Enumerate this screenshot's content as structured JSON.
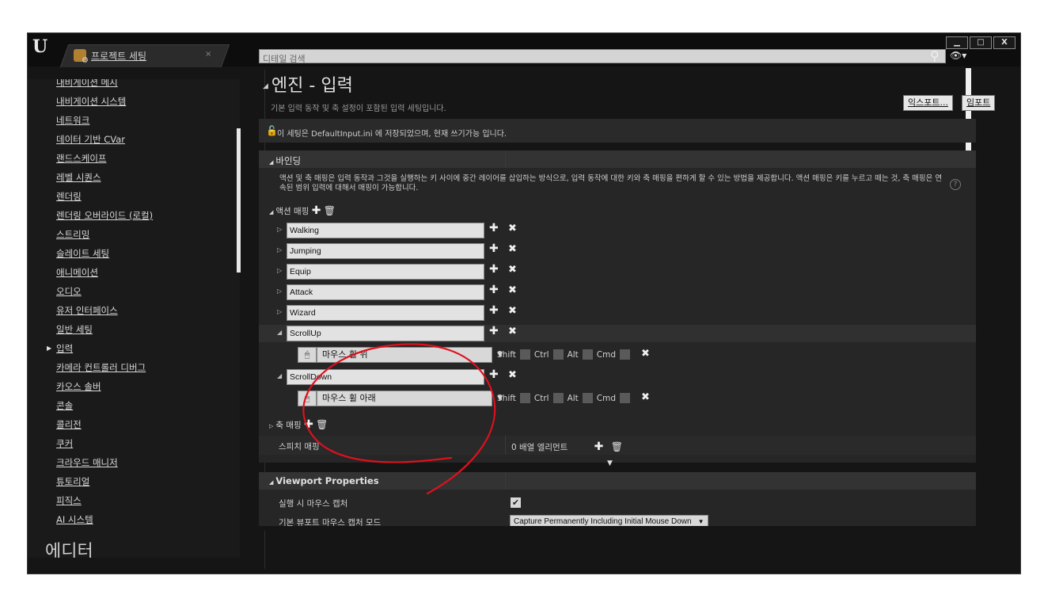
{
  "window": {
    "tab_title": "프로젝트 세팅",
    "tab_close": "×",
    "controls": {
      "minimize": "▁",
      "maximize": "□",
      "close": "X"
    }
  },
  "sidebar": {
    "items": [
      "내비게이션 메시",
      "내비게이션 시스템",
      "네트워크",
      "데이터 기반 CVar",
      "랜드스케이프",
      "레벨 시퀀스",
      "렌더링",
      "렌더링 오버라이드 (로컬)",
      "스트리밍",
      "슬레이트 세팅",
      "애니메이션",
      "오디오",
      "유저 인터페이스",
      "일반 세팅",
      "입력",
      "카메라 컨트롤러 디버그",
      "카오스 솔버",
      "콘솔",
      "콜리전",
      "쿠커",
      "크라우드 매니저",
      "튜토리얼",
      "피직스",
      "AI 시스템"
    ],
    "selected": "입력",
    "next_section": "에디터"
  },
  "search": {
    "placeholder": "디테일 검색"
  },
  "header": {
    "title": "엔진 - 입력",
    "description": "기본 입력 동작 및 축 설정이 포함된 입력 세팅입니다.",
    "export_label": "익스포트...",
    "import_label": "임포트"
  },
  "info": {
    "text": "이 세팅은 DefaultInput.ini 에 저장되었으며, 현재 쓰기가능 입니다."
  },
  "bindings": {
    "title": "바인딩",
    "description": "액션 및 축 매핑은 입력 동작과 그것을 실행하는 키 사이에 중간 레이어를 삽입하는 방식으로, 입력 동작에 대한 키와 축 매핑을 편하게 할 수 있는 방법을 제공합니다. 액션 매핑은 키를 누르고 떼는 것, 축 매핑은 연속된 범위 입력에 대해서 매핑이 가능합니다.",
    "action_mappings_label": "액션 매핑",
    "actions": [
      {
        "name": "Walking"
      },
      {
        "name": "Jumping"
      },
      {
        "name": "Equip"
      },
      {
        "name": "Attack"
      },
      {
        "name": "Wizard"
      },
      {
        "name": "ScrollUp",
        "key": "마우스 휠 위"
      },
      {
        "name": "ScrollDown",
        "key": "마우스 휠 아래"
      }
    ],
    "modifiers": {
      "shift": "Shift",
      "ctrl": "Ctrl",
      "alt": "Alt",
      "cmd": "Cmd"
    },
    "axis_mappings_label": "축 매핑",
    "speech_label": "스피치 매핑",
    "speech_value": "0 배열 엘리먼트"
  },
  "viewport": {
    "title": "Viewport Properties",
    "capture_label": "실행 시 마우스 캡처",
    "capture_checked": true,
    "capture_mode_label": "기본 뷰포트 마우스 캡처 모드",
    "capture_mode_value": "Capture Permanently Including Initial Mouse Down"
  },
  "colors": {
    "accent_annotation": "#e0101e",
    "panel": "#2c2c2c",
    "background": "#151515"
  }
}
